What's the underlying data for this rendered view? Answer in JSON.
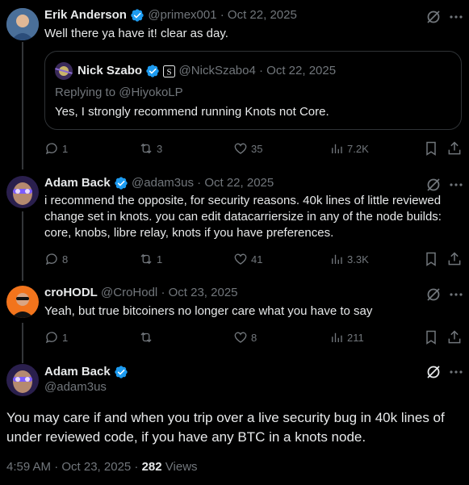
{
  "tweets": [
    {
      "author": "Erik Anderson",
      "handle": "@primex001",
      "date": "Oct 22, 2025",
      "text": "Well there ya have it! clear as day.",
      "quote": {
        "author": "Nick Szabo",
        "handle": "@NickSzabo4",
        "date": "Oct 22, 2025",
        "reply_to": "Replying to @HiyokoLP",
        "text": "Yes, I strongly recommend running Knots not Core."
      },
      "actions": {
        "replies": "1",
        "retweets": "3",
        "likes": "35",
        "views": "7.2K"
      }
    },
    {
      "author": "Adam Back",
      "handle": "@adam3us",
      "date": "Oct 22, 2025",
      "text_lines": [
        "i recommend the opposite, for security reasons. 40k lines of little reviewed",
        "change set in knots. you can edit datacarriersize in any of the node builds:",
        "core, knobs, libre relay, knots if you have preferences."
      ],
      "actions": {
        "replies": "8",
        "retweets": "1",
        "likes": "41",
        "views": "3.3K"
      }
    },
    {
      "author": "croHODL",
      "handle": "@CroHodl",
      "date": "Oct 23, 2025",
      "text": "Yeah, but true bitcoiners no longer care what you have to say",
      "actions": {
        "replies": "1",
        "retweets": "",
        "likes": "8",
        "views": "211"
      }
    }
  ],
  "main_tweet": {
    "author": "Adam Back",
    "handle": "@adam3us",
    "text_lines": [
      "You may care if and when you trip over a live security bug in 40k lines of",
      "under reviewed code, if you have any BTC in a knots node."
    ],
    "timestamp": "4:59 AM · Oct 23, 2025 · ",
    "views_count": "282",
    "views_label": " Views"
  },
  "separator": "·",
  "colors": {
    "background": "#000000",
    "text": "#e7e9ea",
    "muted": "#71767b",
    "verified": "#1d9bf0",
    "border": "#2f3336"
  }
}
